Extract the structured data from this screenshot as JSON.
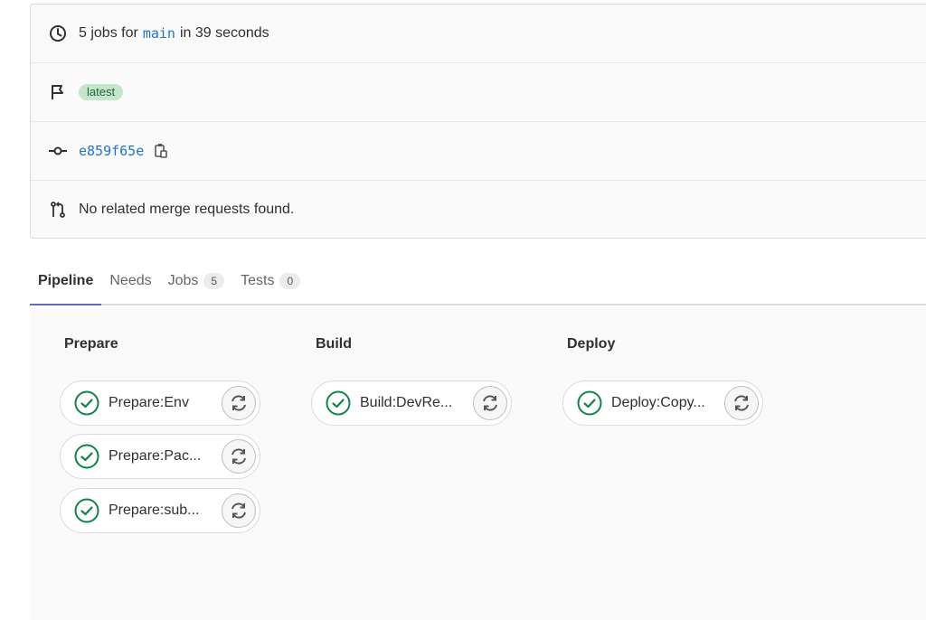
{
  "summary": {
    "jobs_prefix": "5 jobs for",
    "branch": "main",
    "duration": "in 39 seconds",
    "badge": "latest",
    "commit_sha": "e859f65e",
    "merge_requests": "No related merge requests found."
  },
  "tabs": [
    {
      "label": "Pipeline",
      "count": ""
    },
    {
      "label": "Needs",
      "count": ""
    },
    {
      "label": "Jobs",
      "count": "5"
    },
    {
      "label": "Tests",
      "count": "0"
    }
  ],
  "stages": [
    {
      "title": "Prepare",
      "jobs": [
        "Prepare:Env",
        "Prepare:Pac...",
        "Prepare:sub..."
      ]
    },
    {
      "title": "Build",
      "jobs": [
        "Build:DevRe..."
      ]
    },
    {
      "title": "Deploy",
      "jobs": [
        "Deploy:Copy..."
      ]
    }
  ],
  "colors": {
    "success": "#108548",
    "link": "#1f75cb",
    "active_tab": "#6666c4"
  },
  "icons": {
    "duration": "clock-icon",
    "badge": "flag-icon",
    "commit": "commit-icon",
    "copy": "copy-icon",
    "merge_request": "merge-request-icon",
    "job_status": "status-success-icon",
    "retry": "retry-icon"
  }
}
